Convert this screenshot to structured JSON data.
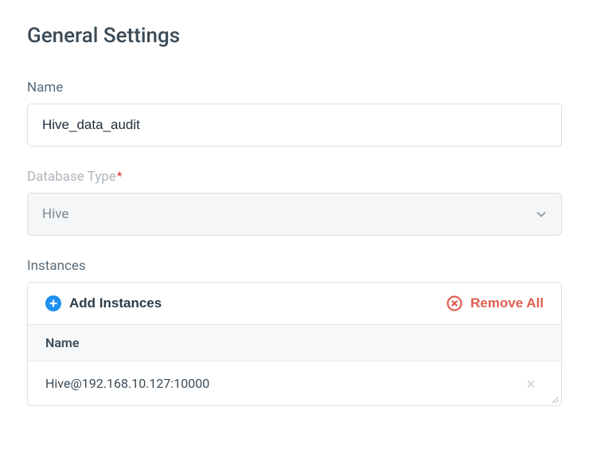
{
  "title": "General Settings",
  "fields": {
    "name": {
      "label": "Name",
      "value": "Hive_data_audit"
    },
    "db_type": {
      "label": "Database Type",
      "required_mark": "*",
      "value": "Hive"
    }
  },
  "instances": {
    "section_label": "Instances",
    "add_label": "Add Instances",
    "remove_all_label": "Remove All",
    "column_header": "Name",
    "rows": [
      {
        "name": "Hive@192.168.10.127:10000"
      }
    ]
  }
}
